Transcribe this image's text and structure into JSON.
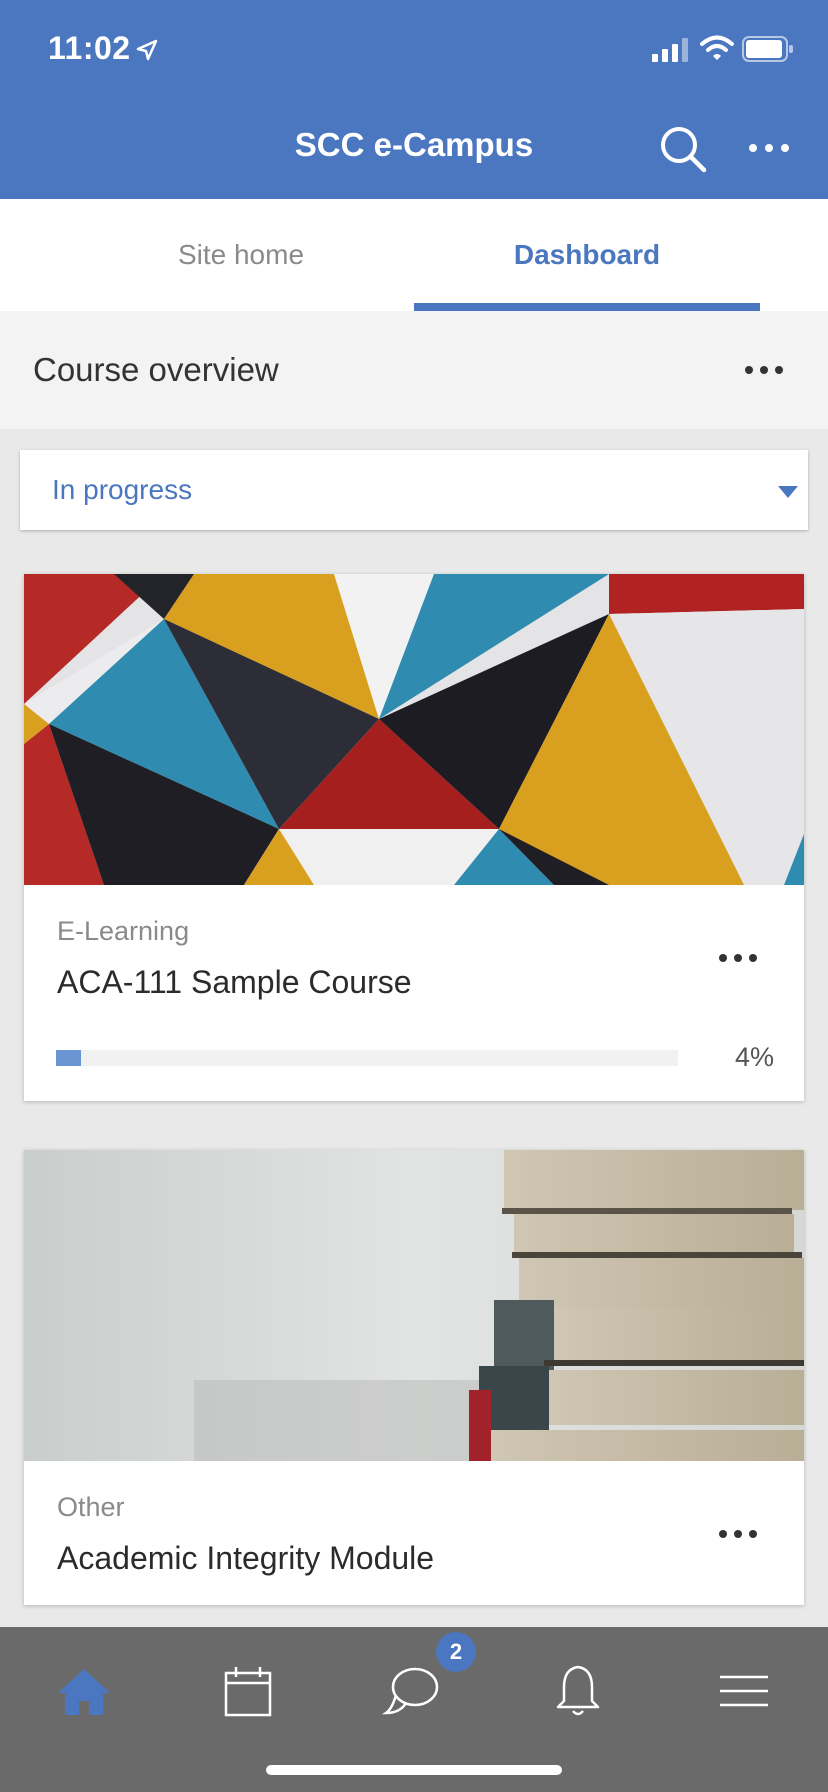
{
  "status_bar": {
    "time": "11:02"
  },
  "header": {
    "title": "SCC e-Campus"
  },
  "tabs": [
    {
      "label": "Site home",
      "active": false
    },
    {
      "label": "Dashboard",
      "active": true
    }
  ],
  "overview": {
    "title": "Course overview"
  },
  "filter": {
    "selected": "In progress"
  },
  "courses": [
    {
      "category": "E-Learning",
      "name": "ACA-111 Sample Course",
      "progress_label": "4%",
      "progress": 0.04
    },
    {
      "category": "Other",
      "name": "Academic Integrity Module"
    }
  ],
  "bottom_nav": {
    "items": [
      "home-icon",
      "calendar-icon",
      "messages-icon",
      "notifications-icon",
      "menu-icon"
    ],
    "messages_badge": "2"
  },
  "colors": {
    "accent": "#4a77bf",
    "nav_bg": "#6a6a6a",
    "progress": "#6b94d2"
  }
}
